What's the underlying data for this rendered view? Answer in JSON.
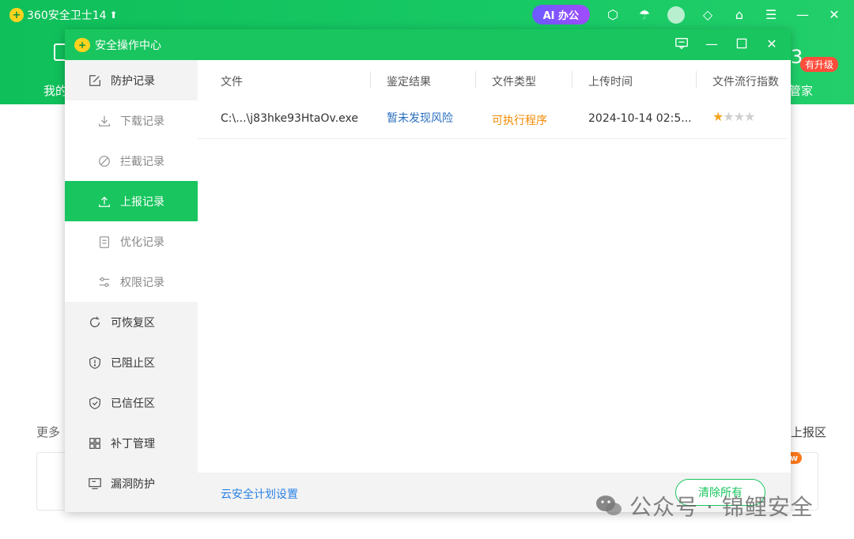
{
  "app": {
    "title": "360安全卫士14",
    "ai_label": "AI 办公"
  },
  "bg": {
    "nav_left": "我的",
    "nav_right": "管家",
    "upgrade_badge": "有升级",
    "more_text": "更多",
    "report_text": "上报区",
    "new_badge": "w"
  },
  "dialog": {
    "title": "安全操作中心",
    "sidebar": {
      "items": [
        {
          "label": "防护记录",
          "icon": "edit-icon",
          "level": "top"
        },
        {
          "label": "下载记录",
          "icon": "download-icon",
          "level": "sub"
        },
        {
          "label": "拦截记录",
          "icon": "block-icon",
          "level": "sub"
        },
        {
          "label": "上报记录",
          "icon": "upload-icon",
          "level": "sub",
          "active": true
        },
        {
          "label": "优化记录",
          "icon": "clipboard-icon",
          "level": "sub"
        },
        {
          "label": "权限记录",
          "icon": "sliders-icon",
          "level": "sub"
        },
        {
          "label": "可恢复区",
          "icon": "refresh-icon",
          "level": "top"
        },
        {
          "label": "已阻止区",
          "icon": "shield-alert-icon",
          "level": "top"
        },
        {
          "label": "已信任区",
          "icon": "shield-check-icon",
          "level": "top"
        },
        {
          "label": "补丁管理",
          "icon": "grid-icon",
          "level": "top"
        },
        {
          "label": "漏洞防护",
          "icon": "monitor-icon",
          "level": "top"
        }
      ]
    },
    "table": {
      "columns": [
        "文件",
        "鉴定结果",
        "文件类型",
        "上传时间",
        "文件流行指数"
      ],
      "rows": [
        {
          "file": "C:\\...\\j83hke93HtaOv.exe",
          "result": "暂未发现风险",
          "type": "可执行程序",
          "time": "2024-10-14 02:5...",
          "popularity_stars": 1,
          "max_stars": 4
        }
      ]
    },
    "footer": {
      "link": "云安全计划设置",
      "clear_button": "清除所有"
    }
  },
  "watermark": {
    "text": "公众号 · 锦鲤安全"
  },
  "colors": {
    "green": "#18c55e",
    "link_blue": "#2a82e4",
    "result_blue": "#2a6ebf",
    "type_orange": "#f08a00",
    "star": "#f5a623"
  }
}
